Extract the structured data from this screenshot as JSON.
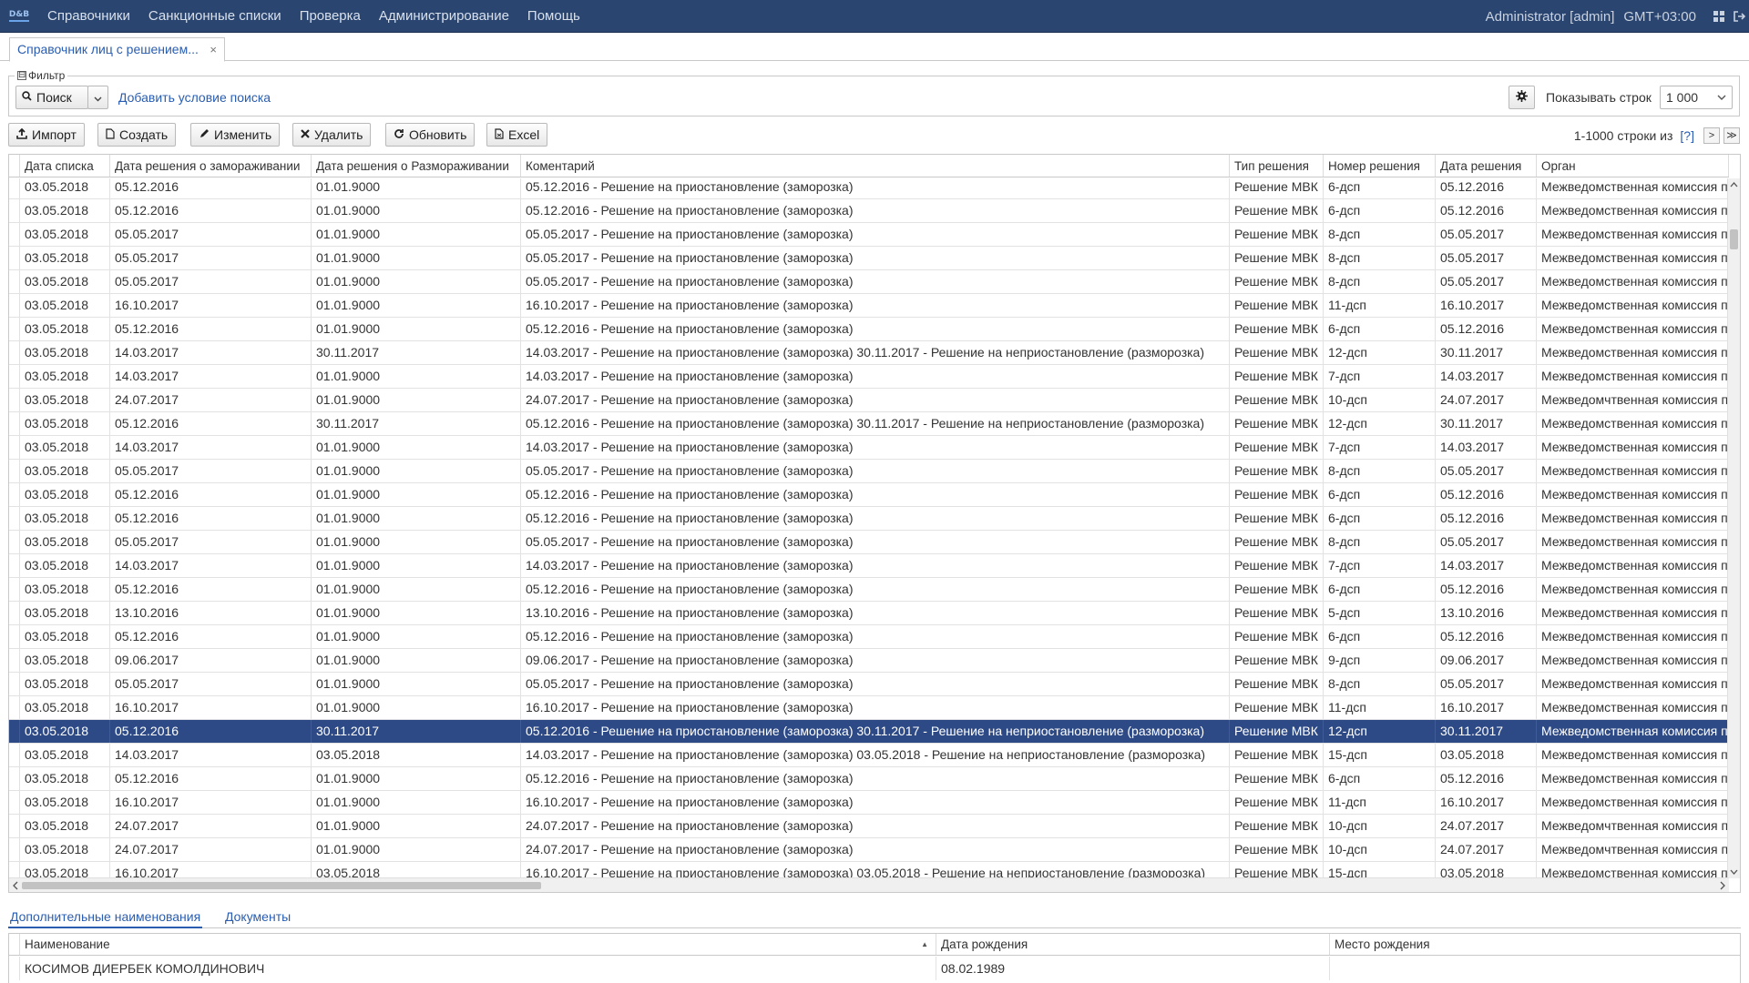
{
  "app": {
    "logo": "D&B"
  },
  "nav": {
    "menu": [
      "Справочники",
      "Санкционные списки",
      "Проверка",
      "Администрирование",
      "Помощь"
    ],
    "user": "Administrator [admin]",
    "timezone": "GMT+03:00"
  },
  "tabs": [
    {
      "label": "Справочник лиц с решением...",
      "close": "×"
    }
  ],
  "filter": {
    "legend": "Фильтр",
    "toggle": "⊟",
    "search_label": "Поиск",
    "add_condition": "Добавить условие поиска",
    "rows_label": "Показывать строк",
    "rows_value": "1 000"
  },
  "toolbar": {
    "import": "Импорт",
    "create": "Создать",
    "edit": "Изменить",
    "delete": "Удалить",
    "refresh": "Обновить",
    "excel": "Excel"
  },
  "pager": {
    "text": "1-1000 строки из",
    "help": "[?]",
    "next": ">",
    "last": "≫"
  },
  "grid": {
    "columns": [
      "Дата списка",
      "Дата решения о замораживании",
      "Дата решения о Размораживании",
      "Коментарий",
      "Тип решения",
      "Номер решения",
      "Дата решения",
      "Орган"
    ],
    "selected_index": 23,
    "rows": [
      [
        "03.05.2018",
        "05.12.2016",
        "01.01.9000",
        "05.12.2016 - Решение на приостановление (заморозка)",
        "Решение МВК",
        "6-дсп",
        "05.12.2016",
        "Межведомственная комиссия п"
      ],
      [
        "03.05.2018",
        "05.12.2016",
        "01.01.9000",
        "05.12.2016 - Решение на приостановление (заморозка)",
        "Решение МВК",
        "6-дсп",
        "05.12.2016",
        "Межведомственная комиссия п"
      ],
      [
        "03.05.2018",
        "05.05.2017",
        "01.01.9000",
        "05.05.2017 - Решение на приостановление (заморозка)",
        "Решение МВК",
        "8-дсп",
        "05.05.2017",
        "Межведомственная комиссия п"
      ],
      [
        "03.05.2018",
        "05.05.2017",
        "01.01.9000",
        "05.05.2017 - Решение на приостановление (заморозка)",
        "Решение МВК",
        "8-дсп",
        "05.05.2017",
        "Межведомственная комиссия п"
      ],
      [
        "03.05.2018",
        "05.05.2017",
        "01.01.9000",
        "05.05.2017 - Решение на приостановление (заморозка)",
        "Решение МВК",
        "8-дсп",
        "05.05.2017",
        "Межведомственная комиссия п"
      ],
      [
        "03.05.2018",
        "16.10.2017",
        "01.01.9000",
        "16.10.2017 - Решение на приостановление (заморозка)",
        "Решение МВК",
        "11-дсп",
        "16.10.2017",
        "Межведомственная комиссия п"
      ],
      [
        "03.05.2018",
        "05.12.2016",
        "01.01.9000",
        "05.12.2016 - Решение на приостановление (заморозка)",
        "Решение МВК",
        "6-дсп",
        "05.12.2016",
        "Межведомственная комиссия п"
      ],
      [
        "03.05.2018",
        "14.03.2017",
        "30.11.2017",
        "14.03.2017 - Решение на приостановление (заморозка) 30.11.2017 - Решение на неприостановление (разморозка)",
        "Решение МВК",
        "12-дсп",
        "30.11.2017",
        "Межведомственная комиссия п"
      ],
      [
        "03.05.2018",
        "14.03.2017",
        "01.01.9000",
        "14.03.2017 - Решение на приостановление (заморозка)",
        "Решение МВК",
        "7-дсп",
        "14.03.2017",
        "Межведомственная комиссия п"
      ],
      [
        "03.05.2018",
        "24.07.2017",
        "01.01.9000",
        "24.07.2017 - Решение на приостановление (заморозка)",
        "Решение МВК",
        "10-дсп",
        "24.07.2017",
        "Межведомчтвенная комиссия п"
      ],
      [
        "03.05.2018",
        "05.12.2016",
        "30.11.2017",
        "05.12.2016 - Решение на приостановление (заморозка) 30.11.2017 - Решение на неприостановление (разморозка)",
        "Решение МВК",
        "12-дсп",
        "30.11.2017",
        "Межведомственная комиссия п"
      ],
      [
        "03.05.2018",
        "14.03.2017",
        "01.01.9000",
        "14.03.2017 - Решение на приостановление (заморозка)",
        "Решение МВК",
        "7-дсп",
        "14.03.2017",
        "Межведомственная комиссия п"
      ],
      [
        "03.05.2018",
        "05.05.2017",
        "01.01.9000",
        "05.05.2017 - Решение на приостановление (заморозка)",
        "Решение МВК",
        "8-дсп",
        "05.05.2017",
        "Межведомственная комиссия п"
      ],
      [
        "03.05.2018",
        "05.12.2016",
        "01.01.9000",
        "05.12.2016 - Решение на приостановление (заморозка)",
        "Решение МВК",
        "6-дсп",
        "05.12.2016",
        "Межведомственная комиссия п"
      ],
      [
        "03.05.2018",
        "05.12.2016",
        "01.01.9000",
        "05.12.2016 - Решение на приостановление (заморозка)",
        "Решение МВК",
        "6-дсп",
        "05.12.2016",
        "Межведомственная комиссия п"
      ],
      [
        "03.05.2018",
        "05.05.2017",
        "01.01.9000",
        "05.05.2017 - Решение на приостановление (заморозка)",
        "Решение МВК",
        "8-дсп",
        "05.05.2017",
        "Межведомственная комиссия п"
      ],
      [
        "03.05.2018",
        "14.03.2017",
        "01.01.9000",
        "14.03.2017 - Решение на приостановление (заморозка)",
        "Решение МВК",
        "7-дсп",
        "14.03.2017",
        "Межведомственная комиссия п"
      ],
      [
        "03.05.2018",
        "05.12.2016",
        "01.01.9000",
        "05.12.2016 - Решение на приостановление (заморозка)",
        "Решение МВК",
        "6-дсп",
        "05.12.2016",
        "Межведомственная комиссия п"
      ],
      [
        "03.05.2018",
        "13.10.2016",
        "01.01.9000",
        "13.10.2016 - Решение на приостановление (заморозка)",
        "Решение МВК",
        "5-дсп",
        "13.10.2016",
        "Межведомственная комиссия п"
      ],
      [
        "03.05.2018",
        "05.12.2016",
        "01.01.9000",
        "05.12.2016 - Решение на приостановление (заморозка)",
        "Решение МВК",
        "6-дсп",
        "05.12.2016",
        "Межведомственная комиссия п"
      ],
      [
        "03.05.2018",
        "09.06.2017",
        "01.01.9000",
        "09.06.2017 - Решение на приостановление (заморозка)",
        "Решение МВК",
        "9-дсп",
        "09.06.2017",
        "Межведомственная комиссия п"
      ],
      [
        "03.05.2018",
        "05.05.2017",
        "01.01.9000",
        "05.05.2017 - Решение на приостановление (заморозка)",
        "Решение МВК",
        "8-дсп",
        "05.05.2017",
        "Межведомственная комиссия п"
      ],
      [
        "03.05.2018",
        "16.10.2017",
        "01.01.9000",
        "16.10.2017 - Решение на приостановление (заморозка)",
        "Решение МВК",
        "11-дсп",
        "16.10.2017",
        "Межведомственная комиссия п"
      ],
      [
        "03.05.2018",
        "05.12.2016",
        "30.11.2017",
        "05.12.2016 - Решение на приостановление (заморозка) 30.11.2017 - Решение на неприостановление (разморозка)",
        "Решение МВК",
        "12-дсп",
        "30.11.2017",
        "Межведомственная комиссия п"
      ],
      [
        "03.05.2018",
        "14.03.2017",
        "03.05.2018",
        "14.03.2017 - Решение на приостановление (заморозка) 03.05.2018 - Решение на неприостановление (разморозка)",
        "Решение МВК",
        "15-дсп",
        "03.05.2018",
        "Межведомственная комиссия п"
      ],
      [
        "03.05.2018",
        "05.12.2016",
        "01.01.9000",
        "05.12.2016 - Решение на приостановление (заморозка)",
        "Решение МВК",
        "6-дсп",
        "05.12.2016",
        "Межведомственная комиссия п"
      ],
      [
        "03.05.2018",
        "16.10.2017",
        "01.01.9000",
        "16.10.2017 - Решение на приостановление (заморозка)",
        "Решение МВК",
        "11-дсп",
        "16.10.2017",
        "Межведомственная комиссия п"
      ],
      [
        "03.05.2018",
        "24.07.2017",
        "01.01.9000",
        "24.07.2017 - Решение на приостановление (заморозка)",
        "Решение МВК",
        "10-дсп",
        "24.07.2017",
        "Межведомчтвенная комиссия п"
      ],
      [
        "03.05.2018",
        "24.07.2017",
        "01.01.9000",
        "24.07.2017 - Решение на приостановление (заморозка)",
        "Решение МВК",
        "10-дсп",
        "24.07.2017",
        "Межведомчтвенная комиссия п"
      ],
      [
        "03.05.2018",
        "16.10.2017",
        "03.05.2018",
        "16.10.2017 - Решение на приостановление (заморозка) 03.05.2018 - Решение на неприостановление (разморозка)",
        "Решение МВК",
        "15-дсп",
        "03.05.2018",
        "Межведомственная комиссия п"
      ]
    ]
  },
  "bottom_tabs": [
    "Дополнительные наименования",
    "Документы"
  ],
  "subgrid": {
    "columns": [
      "Наименование",
      "Дата рождения",
      "Место рождения"
    ],
    "sort_indicator": "▲",
    "rows": [
      [
        "КОСИМОВ ДИЕРБЕК КОМОЛДИНОВИЧ",
        "08.02.1989",
        ""
      ]
    ]
  }
}
